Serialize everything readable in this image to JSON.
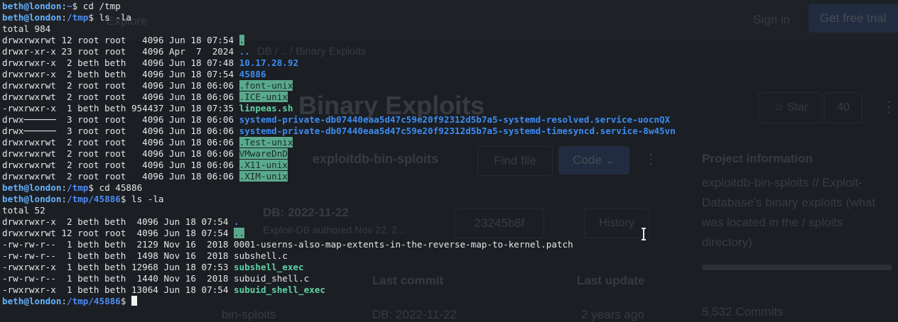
{
  "background_page": {
    "get_free_trial": "Get free trial",
    "sign_in": "Sign in",
    "nav": "Explore",
    "breadcrumb": "DB / .. / Binary Exploits",
    "title": "Binary Exploits",
    "star_label": "☆ Star",
    "star_count": "40",
    "repo_name": "exploitdb-bin-sploits",
    "find_file": "Find file",
    "code_button": "Code ⌄",
    "project_info_heading": "Project information",
    "project_info_desc": "exploitdb-bin-sploits // Exploit-Database's binary exploits (what was located in the / sploits directory)",
    "commit_title": "DB: 2022-11-22",
    "commit_author": "Exploit-DB authored Nov 22, 2...",
    "commit_sha": "23245b8f",
    "history": "History",
    "col_last_commit": "Last commit",
    "col_last_update": "Last update",
    "row_name": "bin-sploits",
    "row_commit": "DB: 2022-11-22",
    "row_update": "2 years ago",
    "commits": "5,532 Commits"
  },
  "terminal": {
    "prompt_user": "beth@london",
    "lines": [
      {
        "type": "prompt",
        "path": "~",
        "cmd": "cd /tmp"
      },
      {
        "type": "prompt",
        "path": "/tmp",
        "cmd": "ls -la"
      },
      {
        "type": "text",
        "text": "total 984"
      },
      {
        "type": "entry",
        "meta": "drwxrwxrwt 12 root root   4096 Jun 18 07:54 ",
        "name": ".",
        "style": "hl"
      },
      {
        "type": "entry",
        "meta": "drwxr-xr-x 23 root root   4096 Apr  7  2024 ",
        "name": "..",
        "style": "dir"
      },
      {
        "type": "entry",
        "meta": "drwxrwxr-x  2 beth beth   4096 Jun 18 07:48 ",
        "name": "10.17.28.92",
        "style": "dir"
      },
      {
        "type": "entry",
        "meta": "drwxrwxr-x  2 beth beth   4096 Jun 18 07:54 ",
        "name": "45886",
        "style": "dir"
      },
      {
        "type": "entry",
        "meta": "drwxrwxrwt  2 root root   4096 Jun 18 06:06 ",
        "name": ".font-unix",
        "style": "sticky"
      },
      {
        "type": "entry",
        "meta": "drwxrwxrwt  2 root root   4096 Jun 18 06:06 ",
        "name": ".ICE-unix",
        "style": "sticky"
      },
      {
        "type": "entry",
        "meta": "-rwxrwxr-x  1 beth beth 954437 Jun 18 07:35 ",
        "name": "linpeas.sh",
        "style": "exec"
      },
      {
        "type": "entry",
        "meta": "drwx──────  3 root root   4096 Jun 18 06:06 ",
        "name": "systemd-private-db07440eaa5d47c59e20f92312d5b7a5-systemd-resolved.service-uocnQX",
        "style": "dir"
      },
      {
        "type": "entry",
        "meta": "drwx──────  3 root root   4096 Jun 18 06:06 ",
        "name": "systemd-private-db07440eaa5d47c59e20f92312d5b7a5-systemd-timesyncd.service-8w45vn",
        "style": "dir"
      },
      {
        "type": "entry",
        "meta": "drwxrwxrwt  2 root root   4096 Jun 18 06:06 ",
        "name": ".Test-unix",
        "style": "sticky"
      },
      {
        "type": "entry",
        "meta": "drwxrwxrwt  2 root root   4096 Jun 18 06:06 ",
        "name": "VMwareDnD",
        "style": "sticky"
      },
      {
        "type": "entry",
        "meta": "drwxrwxrwt  2 root root   4096 Jun 18 06:06 ",
        "name": ".X11-unix",
        "style": "sticky"
      },
      {
        "type": "entry",
        "meta": "drwxrwxrwt  2 root root   4096 Jun 18 06:06 ",
        "name": ".XIM-unix",
        "style": "sticky"
      },
      {
        "type": "prompt",
        "path": "/tmp",
        "cmd": "cd 45886"
      },
      {
        "type": "prompt",
        "path": "/tmp/45886",
        "cmd": "ls -la"
      },
      {
        "type": "text",
        "text": "total 52"
      },
      {
        "type": "entry",
        "meta": "drwxrwxr-x  2 beth beth  4096 Jun 18 07:54 ",
        "name": ".",
        "style": "dir"
      },
      {
        "type": "entry",
        "meta": "drwxrwxrwt 12 root root  4096 Jun 18 07:54 ",
        "name": "..",
        "style": "hl"
      },
      {
        "type": "entry",
        "meta": "-rw-rw-r--  1 beth beth  2129 Nov 16  2018 ",
        "name": "0001-userns-also-map-extents-in-the-reverse-map-to-kernel.patch",
        "style": "plain"
      },
      {
        "type": "entry",
        "meta": "-rw-rw-r--  1 beth beth  1498 Nov 16  2018 ",
        "name": "subshell.c",
        "style": "plain"
      },
      {
        "type": "entry",
        "meta": "-rwxrwxr-x  1 beth beth 12968 Jun 18 07:53 ",
        "name": "subshell_exec",
        "style": "exec"
      },
      {
        "type": "entry",
        "meta": "-rw-rw-r--  1 beth beth  1440 Nov 16  2018 ",
        "name": "subuid_shell.c",
        "style": "plain"
      },
      {
        "type": "entry",
        "meta": "-rwxrwxr-x  1 beth beth 13064 Jun 18 07:54 ",
        "name": "subuid_shell_exec",
        "style": "exec"
      },
      {
        "type": "prompt",
        "path": "/tmp/45886",
        "cmd": "",
        "cursor": true
      }
    ]
  }
}
